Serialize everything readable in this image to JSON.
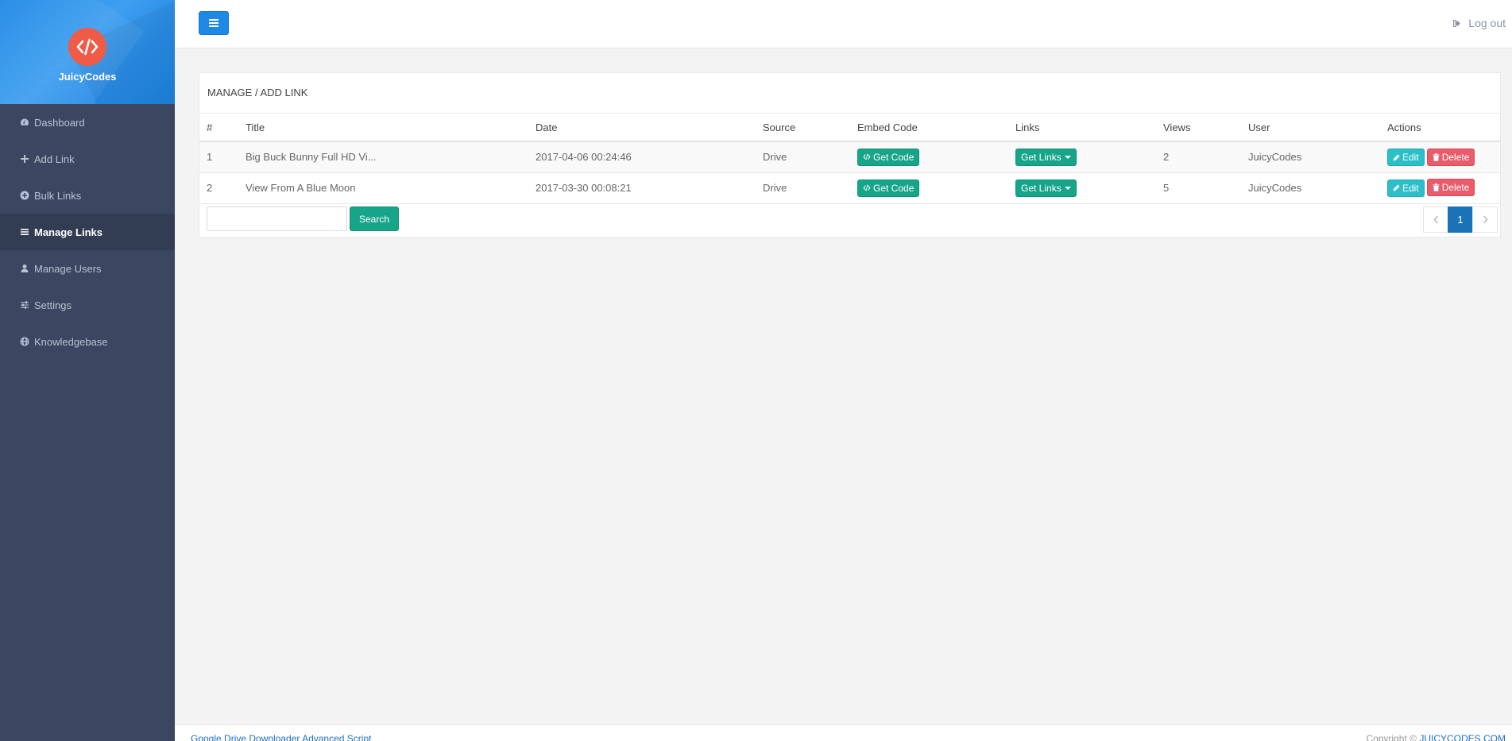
{
  "brand": {
    "name": "JuicyCodes",
    "logo_color": "#ef5b46"
  },
  "sidebar": {
    "items": [
      {
        "label": "Dashboard",
        "icon": "dashboard-icon"
      },
      {
        "label": "Add Link",
        "icon": "plus-icon"
      },
      {
        "label": "Bulk Links",
        "icon": "plus-circle-icon"
      },
      {
        "label": "Manage Links",
        "icon": "list-icon",
        "active": true
      },
      {
        "label": "Manage Users",
        "icon": "user-icon"
      },
      {
        "label": "Settings",
        "icon": "sliders-icon"
      },
      {
        "label": "Knowledgebase",
        "icon": "globe-icon"
      }
    ]
  },
  "topbar": {
    "logout_label": "Log out"
  },
  "panel": {
    "title": "MANAGE / ADD LINK",
    "columns": [
      "#",
      "Title",
      "Date",
      "Source",
      "Embed Code",
      "Links",
      "Views",
      "User",
      "Actions"
    ],
    "rows": [
      {
        "num": "1",
        "title": "Big Buck Bunny Full HD Vi...",
        "date": "2017-04-06 00:24:46",
        "source": "Drive",
        "views": "2",
        "user": "JuicyCodes"
      },
      {
        "num": "2",
        "title": "View From A Blue Moon",
        "date": "2017-03-30 00:08:21",
        "source": "Drive",
        "views": "5",
        "user": "JuicyCodes"
      }
    ],
    "buttons": {
      "get_code": "Get Code",
      "get_links": "Get Links",
      "edit": "Edit",
      "delete": "Delete"
    },
    "search_button": "Search",
    "search_value": "",
    "pagination": {
      "current": "1"
    }
  },
  "footer": {
    "left": "Google Drive Downloader Advanced Script",
    "right_prefix": "Copyright ©",
    "right_link": "JUICYCODES.COM"
  },
  "colors": {
    "accent": "#1e88e5",
    "green": "#17a589",
    "teal": "#2bc0c8",
    "red": "#e85c6b",
    "sidebar": "#3b4760"
  }
}
